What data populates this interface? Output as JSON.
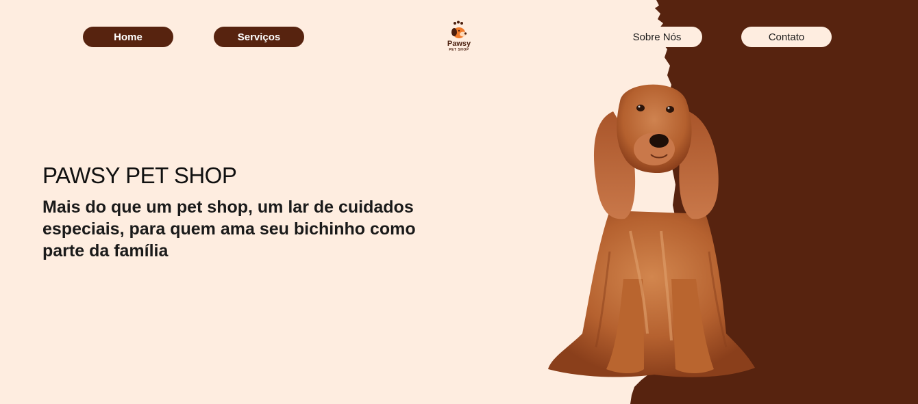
{
  "nav": {
    "home_label": "Home",
    "services_label": "Serviços",
    "about_label": "Sobre Nós",
    "contact_label": "Contato"
  },
  "logo": {
    "name": "Pawsy",
    "subtitle": "PET SHOP",
    "icon": "dog-paw-icon"
  },
  "hero": {
    "title": "PAWSY PET SHOP",
    "tagline": "Mais do que um pet shop, um lar de cuidados especiais, para quem ama seu bichinho como parte da família"
  },
  "image": {
    "subject": "cocker-spaniel-dog"
  },
  "colors": {
    "background": "#feede0",
    "brand_brown": "#57230f",
    "dog_fur": "#b8663a"
  }
}
